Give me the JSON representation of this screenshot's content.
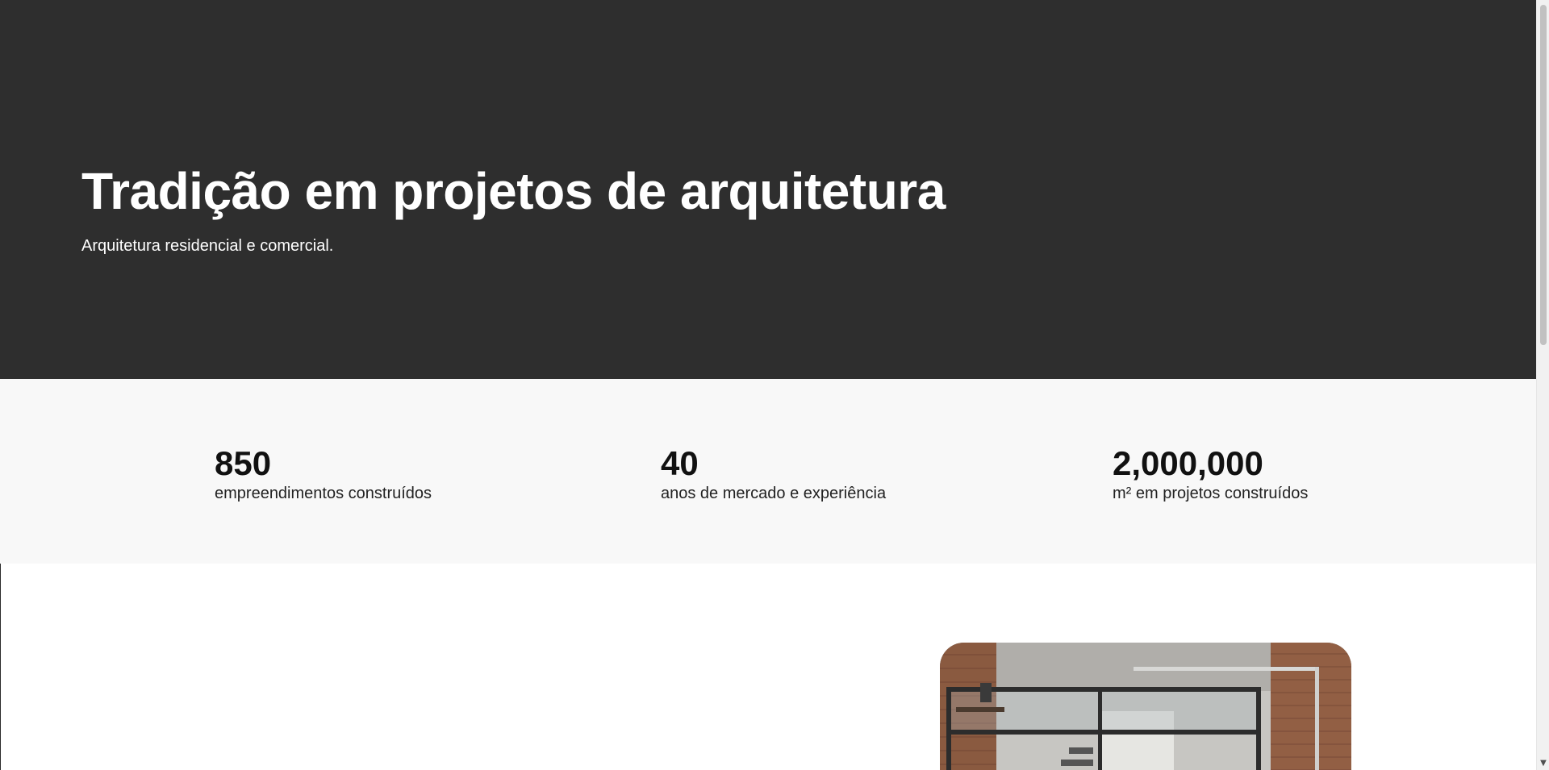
{
  "hero": {
    "title": "Tradição em projetos de arquitetura",
    "subtitle": "Arquitetura residencial e comercial.",
    "background_color": "#2e2e2e"
  },
  "stats": {
    "background_color": "#f8f8f8",
    "items": [
      {
        "value": "850",
        "label": "empreendimentos construídos"
      },
      {
        "value": "40",
        "label": "anos de mercado e experiência"
      },
      {
        "value": "2,000,000",
        "label": "m² em projetos construídos"
      }
    ]
  },
  "photo": {
    "icon": "interior-photo"
  },
  "scrollbar": {
    "down_arrow_icon": "chevron-down-icon"
  }
}
